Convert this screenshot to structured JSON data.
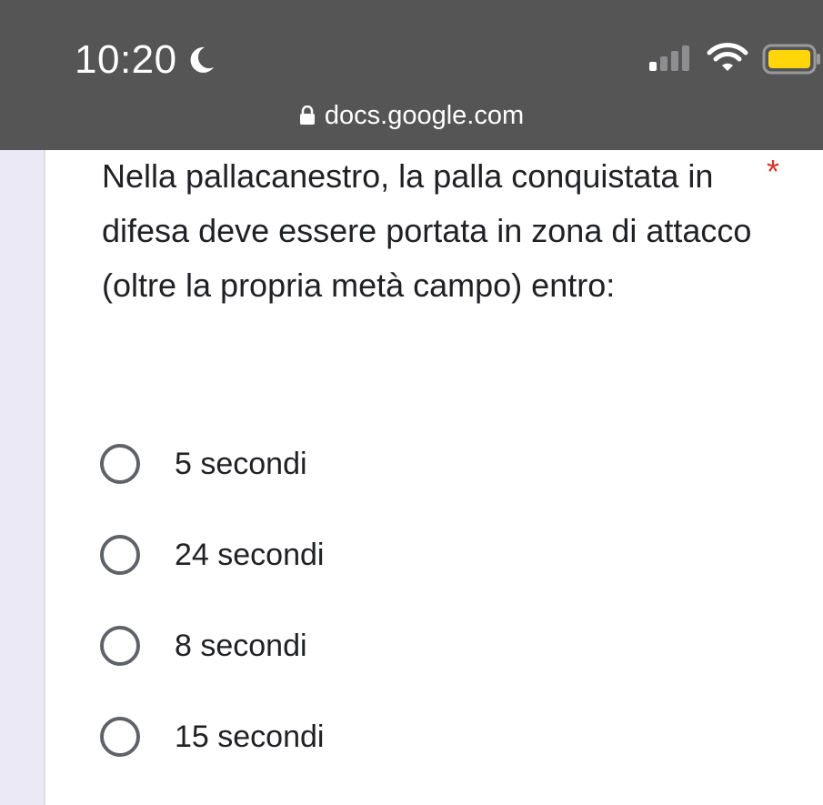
{
  "status_bar": {
    "time": "10:20",
    "moon_icon": "moon-icon",
    "signal_icon": "cellular-signal-icon",
    "wifi_icon": "wifi-icon",
    "battery_icon": "battery-icon",
    "battery_color": "#FFD60A",
    "background_color": "#555556"
  },
  "browser": {
    "url": "docs.google.com",
    "lock_icon": "lock-icon"
  },
  "form": {
    "question": "Nella pallacanestro, la palla conquistata in difesa deve essere portata in zona di attacco (oltre la propria metà campo) entro:",
    "required_marker": "*",
    "accent_color": "#d93025",
    "options": [
      {
        "label": "5 secondi"
      },
      {
        "label": "24 secondi"
      },
      {
        "label": "8 secondi"
      },
      {
        "label": "15 secondi"
      }
    ]
  }
}
